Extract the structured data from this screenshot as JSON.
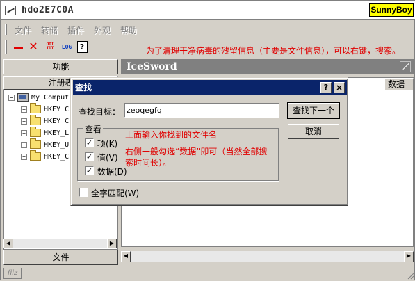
{
  "window": {
    "title": "hdo2E7C0A",
    "badge": "SunnyBoy"
  },
  "menu": {
    "items": [
      "文件",
      "转储",
      "插件",
      "外观",
      "帮助"
    ],
    "annotation": "为了清理干净病毒的残留信息（主要是文件信息），可以右键，搜索。"
  },
  "toolbar": {
    "icons": [
      "minus-icon",
      "delete-icon",
      "odt-icon",
      "log-icon",
      "help-icon"
    ],
    "odt_top": "ODT",
    "odt_bottom": "IDT",
    "log_label": "LOG",
    "help_label": "?"
  },
  "left_panel": {
    "function_button": "功能",
    "registry_button": "注册表",
    "file_button": "文件",
    "tree": [
      {
        "label": "My Comput",
        "expander": "−"
      },
      {
        "label": "HKEY_C",
        "expander": "+"
      },
      {
        "label": "HKEY_C",
        "expander": "+"
      },
      {
        "label": "HKEY_L",
        "expander": "+"
      },
      {
        "label": "HKEY_U",
        "expander": "+"
      },
      {
        "label": "HKEY_C",
        "expander": "+"
      }
    ]
  },
  "right_panel": {
    "header": "IceSword",
    "column_data": "数据"
  },
  "status": {
    "cell": "fiiz"
  },
  "dialog": {
    "title": "查找",
    "help": "?",
    "close": "×",
    "target_label": "查找目标：",
    "target_value": "zeoqegfq",
    "find_next": "查找下一个",
    "cancel": "取消",
    "group_title": "查看",
    "options": [
      {
        "label": "项(K)",
        "checked": true
      },
      {
        "label": "值(V)",
        "checked": true
      },
      {
        "label": "数据(D)",
        "checked": true
      }
    ],
    "match_whole": {
      "label": "全字匹配(W)",
      "checked": false
    },
    "note_top": "上面输入你找到的文件名",
    "note_bottom_1": "右侧一般勾选“数据”即可（当然全部搜",
    "note_bottom_2": "索时间长）。",
    "check_mark": "✓"
  },
  "colors": {
    "title_bg": "#0a246a",
    "annotation_red": "#e00000",
    "badge_yellow": "#ffff00",
    "panel_gray": "#808080"
  }
}
